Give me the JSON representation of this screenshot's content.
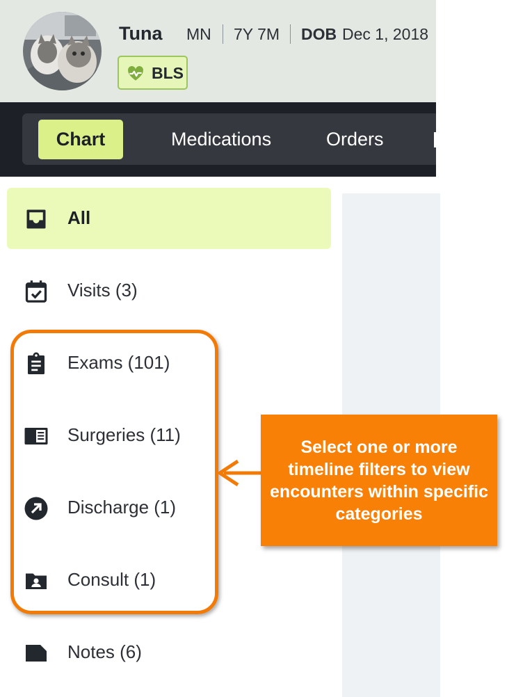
{
  "patient": {
    "name": "Tuna",
    "sex": "MN",
    "age": "7Y 7M",
    "dob_label": "DOB",
    "dob_value": "Dec 1, 2018",
    "badge": "BLS"
  },
  "tabs": [
    {
      "label": "Chart",
      "active": true
    },
    {
      "label": "Medications",
      "active": false
    },
    {
      "label": "Orders",
      "active": false
    }
  ],
  "sidebar": {
    "items": [
      {
        "label": "All",
        "icon": "inbox-icon",
        "active": true
      },
      {
        "label": "Visits (3)",
        "icon": "calendar-check-icon",
        "active": false
      },
      {
        "label": "Exams (101)",
        "icon": "clipboard-icon",
        "active": false
      },
      {
        "label": "Surgeries (11)",
        "icon": "book-open-icon",
        "active": false
      },
      {
        "label": "Discharge (1)",
        "icon": "arrow-circle-icon",
        "active": false
      },
      {
        "label": "Consult (1)",
        "icon": "folder-user-icon",
        "active": false
      },
      {
        "label": "Notes (6)",
        "icon": "note-icon",
        "active": false
      }
    ]
  },
  "callout": {
    "text": "Select one or more timeline filters to view encounters within specific categories"
  },
  "colors": {
    "accent": "#f98006",
    "active_tab": "#dcf08a",
    "active_item": "#ecfab9",
    "header_bg": "#e3e8e3",
    "tabbar_bg": "#1d2127"
  }
}
